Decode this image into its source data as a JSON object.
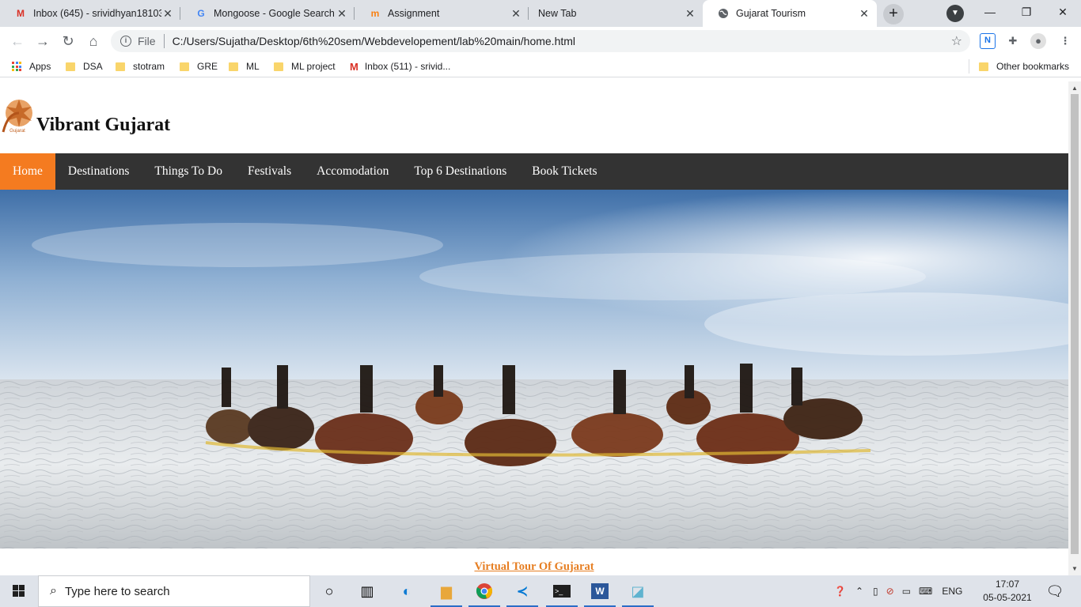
{
  "browser": {
    "tabs": [
      {
        "title": "Inbox (645) - srividhyan18103",
        "icon": "gmail-icon",
        "active": false
      },
      {
        "title": "Mongoose - Google Search",
        "icon": "google-icon",
        "active": false
      },
      {
        "title": "Assignment",
        "icon": "moodle-icon",
        "active": false
      },
      {
        "title": "New Tab",
        "icon": "",
        "active": false
      },
      {
        "title": "Gujarat Tourism",
        "icon": "globe-icon",
        "active": true
      }
    ],
    "address_scheme": "File",
    "address_url": "C:/Users/Sujatha/Desktop/6th%20sem/Webdevelopement/lab%20main/home.html",
    "bookmarks": [
      {
        "label": "Apps",
        "icon": "apps-icon"
      },
      {
        "label": "DSA",
        "icon": "folder-icon"
      },
      {
        "label": "stotram",
        "icon": "folder-icon"
      },
      {
        "label": "GRE",
        "icon": "folder-icon"
      },
      {
        "label": "ML",
        "icon": "folder-icon"
      },
      {
        "label": "ML project",
        "icon": "folder-icon"
      },
      {
        "label": "Inbox (511) - srivid...",
        "icon": "gmail-icon"
      }
    ],
    "other_bookmarks": "Other bookmarks"
  },
  "page": {
    "site_title": "Vibrant Gujarat",
    "logo_text": "Gujarat",
    "nav": [
      {
        "label": "Home",
        "active": true
      },
      {
        "label": "Destinations",
        "active": false
      },
      {
        "label": "Things To Do",
        "active": false
      },
      {
        "label": "Festivals",
        "active": false
      },
      {
        "label": "Accomodation",
        "active": false
      },
      {
        "label": "Top 6 Destinations",
        "active": false
      },
      {
        "label": "Book Tickets",
        "active": false
      }
    ],
    "hero_alt": "garba-dancers-on-white-salt-desert",
    "virtual_tour_link": "Virtual Tour Of Gujarat",
    "colors": {
      "nav_bg": "#333333",
      "nav_active": "#f47b20",
      "link": "#e67e22"
    }
  },
  "taskbar": {
    "search_placeholder": "Type here to search",
    "language": "ENG",
    "time": "17:07",
    "date": "05-05-2021"
  }
}
